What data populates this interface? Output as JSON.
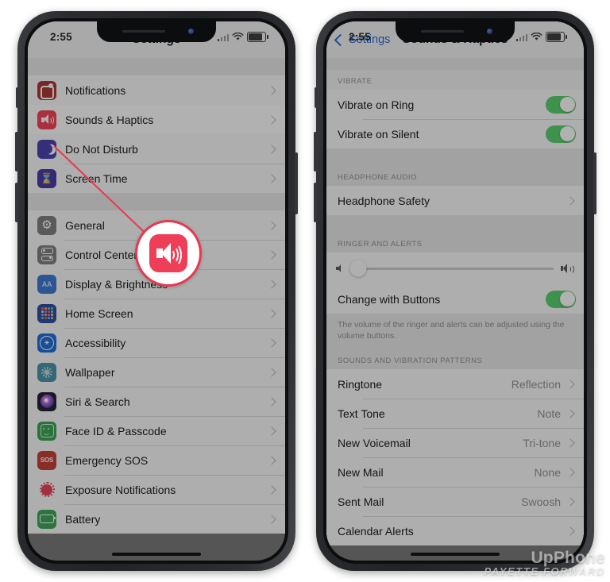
{
  "meta": {
    "watermark_line1": "UpPhone",
    "watermark_line2": "PAYETTE FORWARD"
  },
  "colors": {
    "accent_red": "#e8384f",
    "toggle_green": "#4ecd64",
    "link_blue": "#1d5fd0",
    "sounds_icon": "#f2374b"
  },
  "left_phone": {
    "status": {
      "time": "2:55",
      "signal": "signal-bars",
      "wifi": "wifi-icon",
      "battery": "battery-icon"
    },
    "nav": {
      "title": "Settings"
    },
    "groups": [
      {
        "items": [
          {
            "label": "Notifications",
            "icon": "notifications-icon",
            "highlighted": false
          },
          {
            "label": "Sounds & Haptics",
            "icon": "sounds-haptics-icon",
            "highlighted": true
          },
          {
            "label": "Do Not Disturb",
            "icon": "do-not-disturb-icon",
            "highlighted": false
          },
          {
            "label": "Screen Time",
            "icon": "screen-time-icon",
            "highlighted": false
          }
        ]
      },
      {
        "items": [
          {
            "label": "General",
            "icon": "general-icon",
            "highlighted": false
          },
          {
            "label": "Control Center",
            "icon": "control-center-icon",
            "highlighted": false
          },
          {
            "label": "Display & Brightness",
            "icon": "display-brightness-icon",
            "highlighted": false
          },
          {
            "label": "Home Screen",
            "icon": "home-screen-icon",
            "highlighted": false
          },
          {
            "label": "Accessibility",
            "icon": "accessibility-icon",
            "highlighted": false
          },
          {
            "label": "Wallpaper",
            "icon": "wallpaper-icon",
            "highlighted": false
          },
          {
            "label": "Siri & Search",
            "icon": "siri-search-icon",
            "highlighted": false
          },
          {
            "label": "Face ID & Passcode",
            "icon": "face-id-icon",
            "highlighted": false
          },
          {
            "label": "Emergency SOS",
            "icon": "emergency-sos-icon",
            "highlighted": false
          },
          {
            "label": "Exposure Notifications",
            "icon": "exposure-notifications-icon",
            "highlighted": false
          },
          {
            "label": "Battery",
            "icon": "battery-settings-icon",
            "highlighted": false
          }
        ]
      }
    ],
    "display_brightness_glyph": "AA",
    "sos_glyph": "SOS"
  },
  "right_phone": {
    "status": {
      "time": "2:55",
      "signal": "signal-bars",
      "wifi": "wifi-icon",
      "battery": "battery-icon"
    },
    "nav": {
      "back_label": "Settings",
      "title": "Sounds & Haptics"
    },
    "sections": [
      {
        "header": "VIBRATE",
        "rows": [
          {
            "label": "Vibrate on Ring",
            "type": "toggle",
            "value": "on"
          },
          {
            "label": "Vibrate on Silent",
            "type": "toggle",
            "value": "on"
          }
        ]
      },
      {
        "header": "HEADPHONE AUDIO",
        "rows": [
          {
            "label": "Headphone Safety",
            "type": "disclosure",
            "value": ""
          }
        ]
      },
      {
        "header": "RINGER AND ALERTS",
        "slider": {
          "name": "ringer-volume-slider",
          "percent": 2,
          "left_icon": "speaker-low-icon",
          "right_icon": "speaker-high-icon"
        },
        "rows": [
          {
            "label": "Change with Buttons",
            "type": "toggle",
            "value": "on"
          }
        ],
        "footnote": "The volume of the ringer and alerts can be adjusted using the volume buttons."
      },
      {
        "header": "SOUNDS AND VIBRATION PATTERNS",
        "rows": [
          {
            "label": "Ringtone",
            "type": "value",
            "value": "Reflection"
          },
          {
            "label": "Text Tone",
            "type": "value",
            "value": "Note"
          },
          {
            "label": "New Voicemail",
            "type": "value",
            "value": "Tri-tone"
          },
          {
            "label": "New Mail",
            "type": "value",
            "value": "None"
          },
          {
            "label": "Sent Mail",
            "type": "value",
            "value": "Swoosh"
          },
          {
            "label": "Calendar Alerts",
            "type": "value",
            "value": ""
          }
        ]
      }
    ]
  },
  "callout": {
    "name": "sounds-haptics-magnified-callout",
    "icon": "sounds-haptics-icon",
    "pointer": "red-arrow-line"
  }
}
